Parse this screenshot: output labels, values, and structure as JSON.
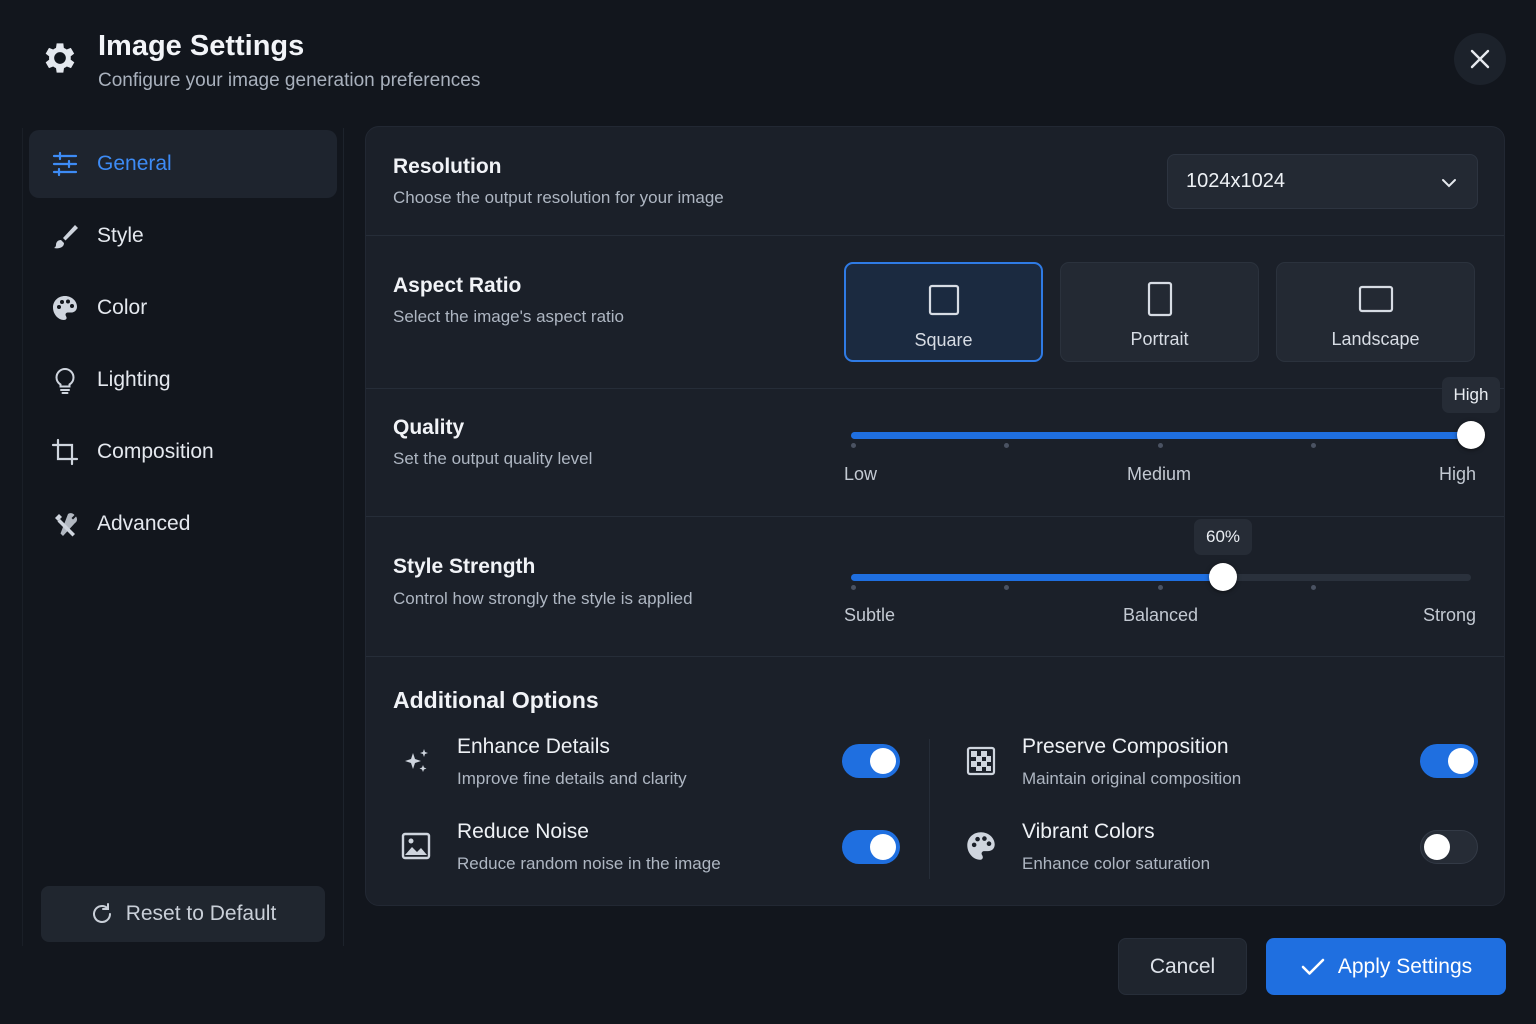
{
  "header": {
    "title": "Image Settings",
    "subtitle": "Configure your image generation preferences",
    "icon": "gear-icon",
    "close_icon": "close-icon"
  },
  "sidebar": {
    "items": [
      {
        "label": "General",
        "icon": "sliders-icon",
        "active": true
      },
      {
        "label": "Style",
        "icon": "brush-icon",
        "active": false
      },
      {
        "label": "Color",
        "icon": "palette-icon",
        "active": false
      },
      {
        "label": "Lighting",
        "icon": "lightbulb-icon",
        "active": false
      },
      {
        "label": "Composition",
        "icon": "crop-icon",
        "active": false
      },
      {
        "label": "Advanced",
        "icon": "tools-icon",
        "active": false
      }
    ],
    "reset_label": "Reset to Default"
  },
  "resolution": {
    "title": "Resolution",
    "description": "Choose the output resolution for your image",
    "selected": "1024x1024"
  },
  "aspect_ratio": {
    "title": "Aspect Ratio",
    "description": "Select the image's aspect ratio",
    "options": [
      {
        "label": "Square",
        "selected": true
      },
      {
        "label": "Portrait",
        "selected": false
      },
      {
        "label": "Landscape",
        "selected": false
      }
    ]
  },
  "quality": {
    "title": "Quality",
    "description": "Set the output quality level",
    "value_label": "High",
    "fraction": 1.0,
    "labels": [
      "Low",
      "Medium",
      "High"
    ]
  },
  "style_strength": {
    "title": "Style Strength",
    "description": "Control how strongly the style is applied",
    "value_label": "60%",
    "fraction": 0.6,
    "labels": [
      "Subtle",
      "Balanced",
      "Strong"
    ]
  },
  "additional": {
    "title": "Additional Options",
    "options": [
      {
        "title": "Enhance Details",
        "description": "Improve fine details and clarity",
        "icon": "sparkles-icon",
        "enabled": true
      },
      {
        "title": "Preserve Composition",
        "description": "Maintain original composition",
        "icon": "grid-icon",
        "enabled": true
      },
      {
        "title": "Reduce Noise",
        "description": "Reduce random noise in the image",
        "icon": "image-icon",
        "enabled": true
      },
      {
        "title": "Vibrant Colors",
        "description": "Enhance color saturation",
        "icon": "palette-icon",
        "enabled": false
      }
    ]
  },
  "footer": {
    "cancel_label": "Cancel",
    "apply_label": "Apply Settings"
  },
  "colors": {
    "accent": "#1f6fe0",
    "background": "#12161d",
    "panel": "#1b2029"
  }
}
